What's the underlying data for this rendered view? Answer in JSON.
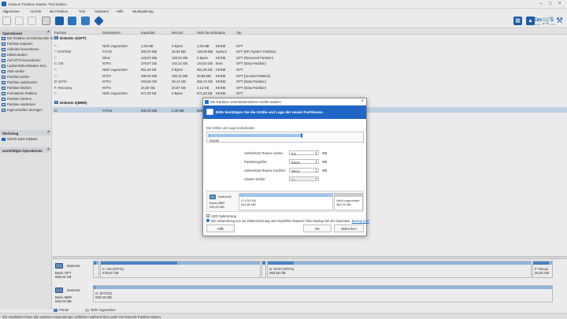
{
  "window": {
    "title": "Easeus Partition Master Trial Edition"
  },
  "menu": [
    "Allgemeine",
    "Ansicht",
    "die Partition",
    "Tool",
    "Assistent",
    "Hilfe",
    "Studioplaning"
  ],
  "brand": {
    "name": "EaseUS",
    "sub": "MAKE YOUR LIFE EASY"
  },
  "left": {
    "operations_header": "Operationen",
    "operations": [
      "Die Partition verschieben/die Gr...",
      "Partition kopieren",
      "Aufteilen konvertieren",
      "Etikett ändern",
      "Auf NTFS konvertieren",
      "Laufwerksbuchstaben änd...",
      "Aktiv stellen",
      "Partition prüfen",
      "Partition ausblenden",
      "Partition löschen",
      "Formatierte Partition",
      "Partition löschen",
      "Partition entdecken",
      "Eigenschaften anzeigen"
    ],
    "wizard_header": "Werkzeug",
    "wizard_item": "WinPE Boot Diskette",
    "pending_header": "anstehtliget Operationen"
  },
  "columns": [
    "Partition",
    "Dateisystem",
    "Kapazität",
    "Benutzt",
    "Nicht benutzt",
    "Status",
    "Typ"
  ],
  "disk1": {
    "label": "Diskette 1(GPT)",
    "rows": [
      [
        "*:",
        "Nicht zugeordnet",
        "1,00 MB",
        "0 Bytes",
        "1,00 MB",
        "KEINE",
        "GPT"
      ],
      [
        "*: SYSTEM",
        "FAT32",
        "260,00 MB",
        "46,93 MB",
        "159,08 MB",
        "System",
        "GPT (EFI System Partition)"
      ],
      [
        "*:",
        "Other",
        "128,00 MB",
        "128,00 MB",
        "0 Bytes",
        "KEINE",
        "GPT (Reserved Partition)"
      ],
      [
        "C: OS",
        "NTFS",
        "278,97 GB",
        "134,13 GB",
        "144,84 GB",
        "Boot",
        "GPT (Data Partition)"
      ],
      [
        "*:",
        "Nicht zugeordnet",
        "951,00 KB",
        "0 Bytes",
        "951,00 KB",
        "KEINE",
        "GPT"
      ],
      [
        "*:",
        "NTFS",
        "496,00 MB",
        "456,42 MB",
        "39,58 MB",
        "KEINE",
        "GPT (Unused Partition)"
      ],
      [
        "D: DATA",
        "NTFS",
        "393,66 GB",
        "38,13 GB",
        "355,70 GB",
        "KEINE",
        "GPT (Data Partition)"
      ],
      [
        "F: Recovery",
        "NTFS",
        "25,00 GB",
        "20,87 GB",
        "4,13 GB",
        "KEINE",
        "GPT (Data Partition)"
      ],
      [
        "*:",
        "Nicht zugeordnet",
        "671,00 KB",
        "0 Bytes",
        "671,00 KB",
        "KEINE",
        "GPT"
      ]
    ]
  },
  "disk2": {
    "label": "Diskette 2(MBR)",
    "rows": [
      [
        "G:",
        "FAT16",
        "930,00 MB",
        "2,40 MB",
        "926,59 MB",
        "KEINE",
        "Primär"
      ]
    ]
  },
  "diskmap": [
    {
      "name": "Datenträ",
      "type": "Basis GPT",
      "size": "698,64 GB",
      "parts": [
        {
          "l1": "",
          "l2": "",
          "fill": 0.5
        },
        {
          "l1": "C: OS (NTFS)",
          "l2": "278,97 GB",
          "fill": 0.48
        },
        {
          "l1": "",
          "l2": "",
          "fill": 0.9
        },
        {
          "l1": "D: DATA (NTFS)",
          "l2": "393,66 GB",
          "fill": 0.1
        },
        {
          "l1": "F: Recov",
          "l2": "25,00 GB",
          "fill": 0.83
        }
      ]
    },
    {
      "name": "Datenträ",
      "type": "Basis MBR",
      "size": "930,00 MB",
      "parts": [
        {
          "l1": "G: (FAT16)",
          "l2": "930,00 MB",
          "fill": 0.003
        }
      ]
    }
  ],
  "legend": {
    "primary": "Primär",
    "unallocated": "Nicht zugeordnet"
  },
  "statusbar": "Wir empfehlen Ihnen alle anderen Anwendungen schließen während des Laufs von EaseUS Partition Master.",
  "dialog": {
    "title": "Die Partition verschieben/deren Größe ändern",
    "banner": "Bitte bestätigen Sie die Größe und Lage der neuen Partitionen.",
    "size_section": "Die Größe und Lage entscheiden",
    "bar_value": "594MB",
    "fields": [
      {
        "label": "Unbesetzte Raume vorher:",
        "value": "0,0",
        "unit": "MB"
      },
      {
        "label": "Partitionsgröße:",
        "value": "594,6",
        "unit": "MB"
      },
      {
        "label": "Unbesetzte Raume nachher:",
        "value": "384,4",
        "unit": "MB"
      },
      {
        "label": "Cluster-Größe:",
        "value": "2K",
        "unit": ""
      }
    ],
    "preview": {
      "name": "Datenträ2",
      "type": "Basis MBR",
      "size": "930,00 MB",
      "p1": {
        "l1": "G: (FAT16)",
        "l2": "544,86 MB"
      },
      "p2": {
        "l1": "Nicht zugeordnet",
        "l2": "384,00 MB"
      }
    },
    "ssd": "SSD Optimierung",
    "note": "Die Verwendung von zur Datensicherung und empfehlen EaseUS Todo Backup bei der Operation.",
    "note_link": "Backup jetzt",
    "help": "Hilfe",
    "ok": "OK",
    "cancel": "abbrechen"
  }
}
